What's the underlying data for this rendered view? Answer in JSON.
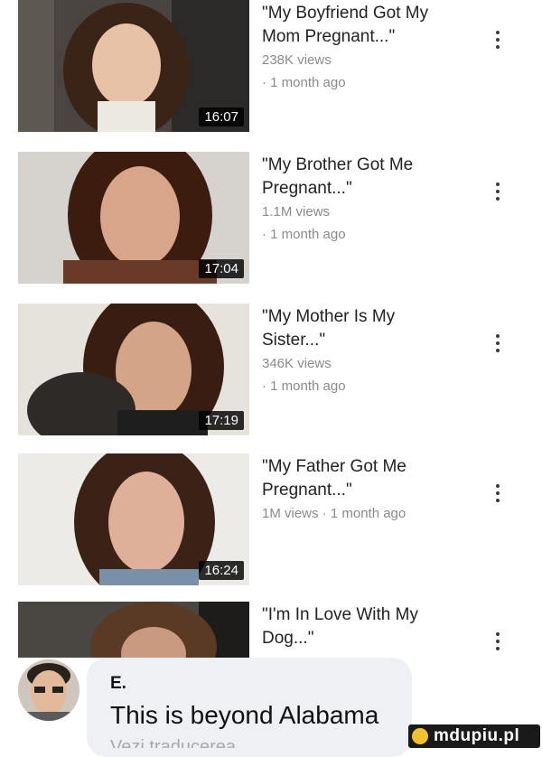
{
  "videos": [
    {
      "title_line1": "\"My Boyfriend Got My",
      "title_line2": "Mom Pregnant...\"",
      "sub_line1": "238K views",
      "sub_line2": "· 1 month ago",
      "duration": "16:07"
    },
    {
      "title_line1": "\"My Brother Got Me",
      "title_line2": "Pregnant...\"",
      "sub_line1": "1.1M views",
      "sub_line2": "· 1 month ago",
      "duration": "17:04"
    },
    {
      "title_line1": "\"My Mother Is My",
      "title_line2": "Sister...\"",
      "sub_line1": "346K views",
      "sub_line2": "· 1 month ago",
      "duration": "17:19"
    },
    {
      "title_line1": "\"My Father Got Me",
      "title_line2": "Pregnant...\"",
      "sub_line1": "1M views · 1 month ago",
      "sub_line2": "",
      "duration": "16:24"
    },
    {
      "title_line1": "\"I'm In Love With My",
      "title_line2": "Dog...\"",
      "sub_line1": "",
      "sub_line2": "",
      "duration": ""
    }
  ],
  "comment": {
    "author": "E.",
    "text": "This is beyond Alabama",
    "reply_hint": "Vezi traducerea"
  },
  "watermark": {
    "text": "mdupiu.pl"
  },
  "colors": {
    "meta_gray": "#8a8a8a",
    "comment_bg": "#eef0f3"
  }
}
